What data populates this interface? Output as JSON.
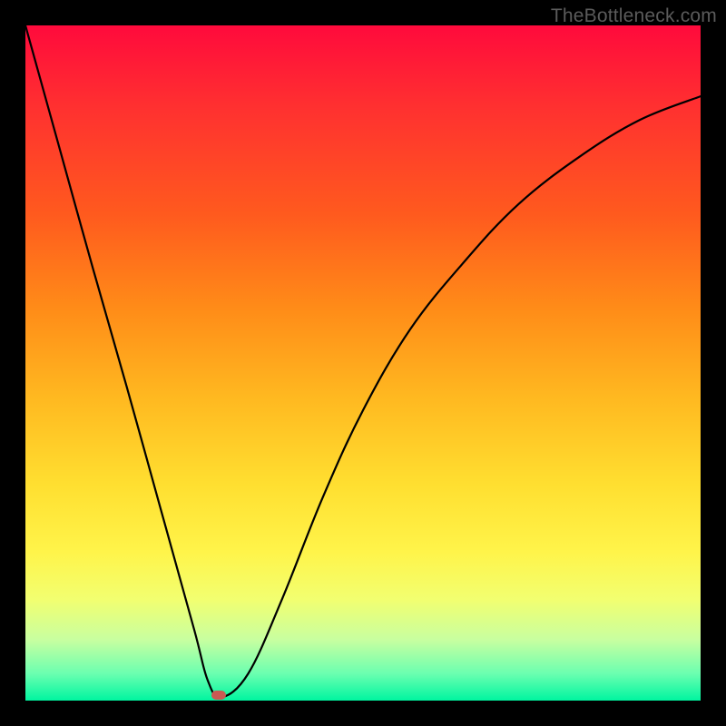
{
  "watermark": "TheBottleneck.com",
  "marker": {
    "color": "#c95a53"
  },
  "chart_data": {
    "type": "line",
    "title": "",
    "xlabel": "",
    "ylabel": "",
    "xlim": [
      0,
      100
    ],
    "ylim": [
      0,
      100
    ],
    "series": [
      {
        "name": "curve",
        "x": [
          0,
          5,
          10,
          15,
          20,
          25,
          27,
          29,
          33,
          38,
          44,
          50,
          57,
          65,
          73,
          82,
          91,
          100
        ],
        "values": [
          100,
          82,
          64,
          46.5,
          28.5,
          10.5,
          3,
          0.5,
          4,
          15,
          30,
          43,
          55,
          65,
          73.5,
          80.5,
          86,
          89.5
        ]
      }
    ],
    "marker_point": {
      "x": 28.6,
      "y": 0.8
    }
  }
}
